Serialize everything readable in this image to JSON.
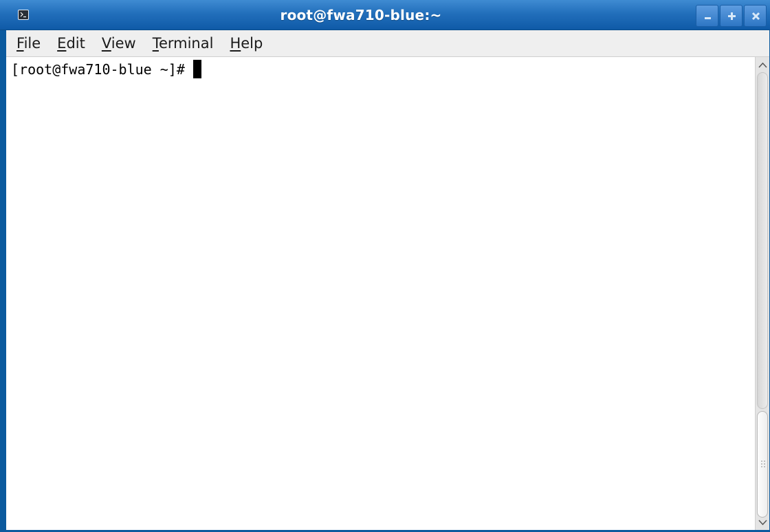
{
  "window": {
    "title": "root@fwa710-blue:~",
    "app_icon": "terminal-icon",
    "controls": [
      "minimize-icon",
      "maximize-icon",
      "close-icon"
    ]
  },
  "menubar": {
    "items": [
      {
        "mnemonic": "F",
        "rest": "ile"
      },
      {
        "mnemonic": "E",
        "rest": "dit"
      },
      {
        "mnemonic": "V",
        "rest": "iew"
      },
      {
        "mnemonic": "T",
        "rest": "erminal"
      },
      {
        "mnemonic": "H",
        "rest": "elp"
      }
    ]
  },
  "terminal": {
    "prompt": "[root@fwa710-blue ~]#"
  },
  "colors": {
    "titlebar": "#226fbb",
    "window_border": "#0b5a9e",
    "menubar_bg": "#efefef",
    "terminal_bg": "#ffffff",
    "terminal_fg": "#000000"
  }
}
